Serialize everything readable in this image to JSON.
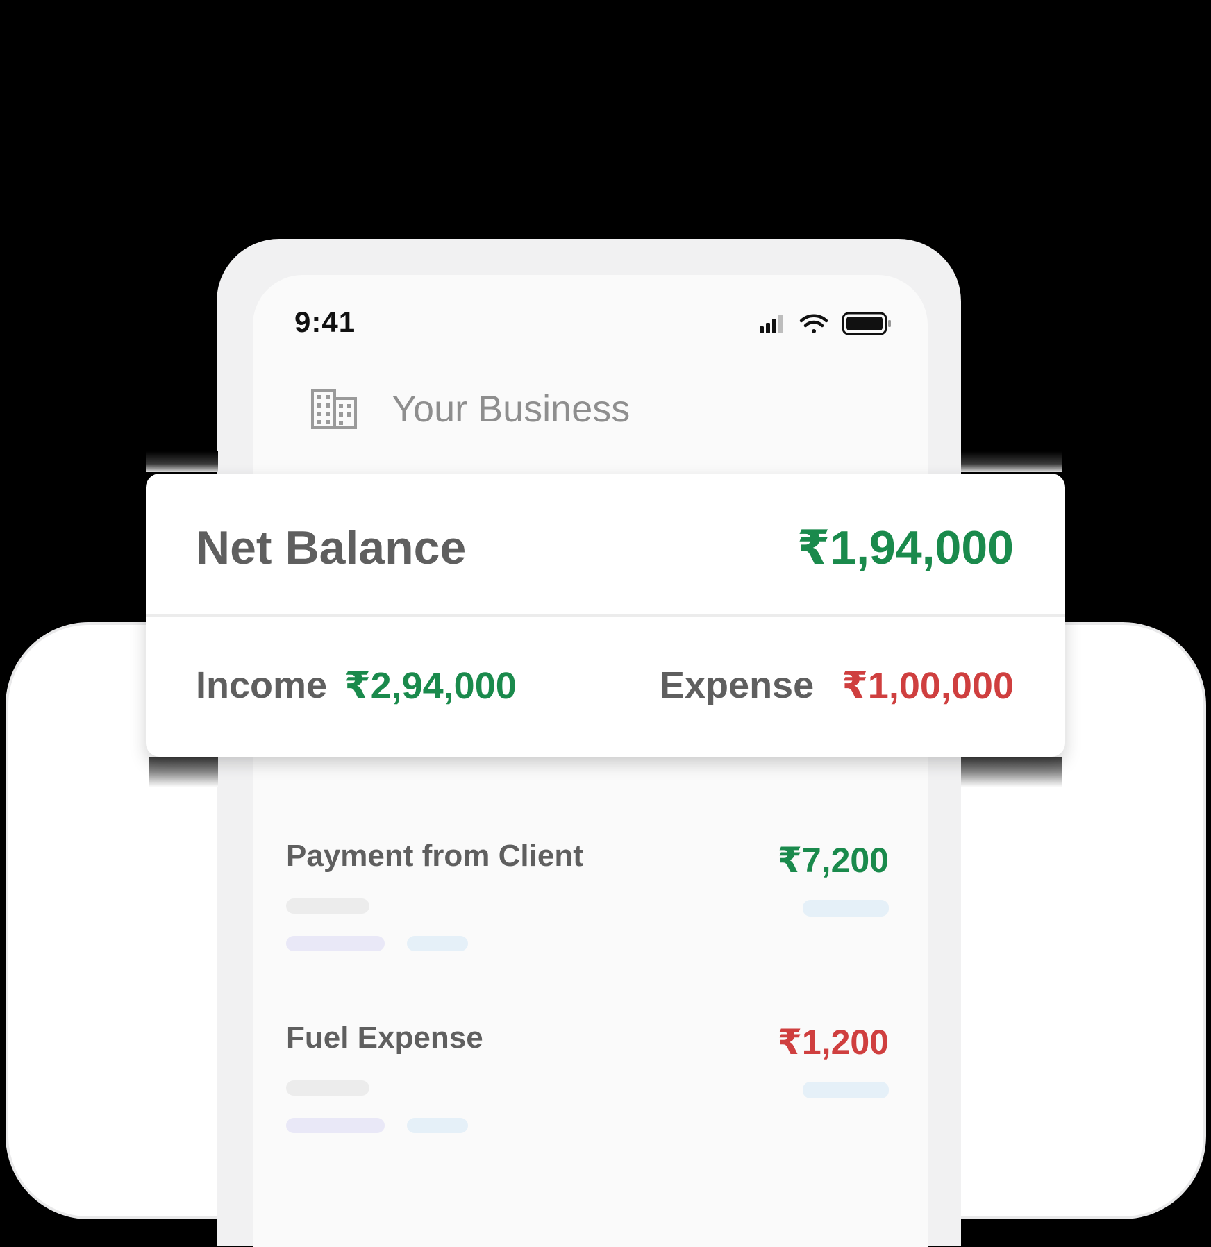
{
  "status_bar": {
    "time": "9:41"
  },
  "header": {
    "icon": "building-icon",
    "title": "Your Business"
  },
  "summary": {
    "net_balance_label": "Net Balance",
    "net_balance_value": "₹1,94,000",
    "income_label": "Income",
    "income_value": "₹2,94,000",
    "expense_label": "Expense",
    "expense_value": "₹1,00,000"
  },
  "transactions": [
    {
      "title": "Payment from Client",
      "amount": "₹7,200",
      "type": "income"
    },
    {
      "title": "Fuel Expense",
      "amount": "₹1,200",
      "type": "expense"
    }
  ],
  "colors": {
    "income": "#1a8a4c",
    "expense": "#cf3f3f",
    "label": "#5f5f5f"
  }
}
